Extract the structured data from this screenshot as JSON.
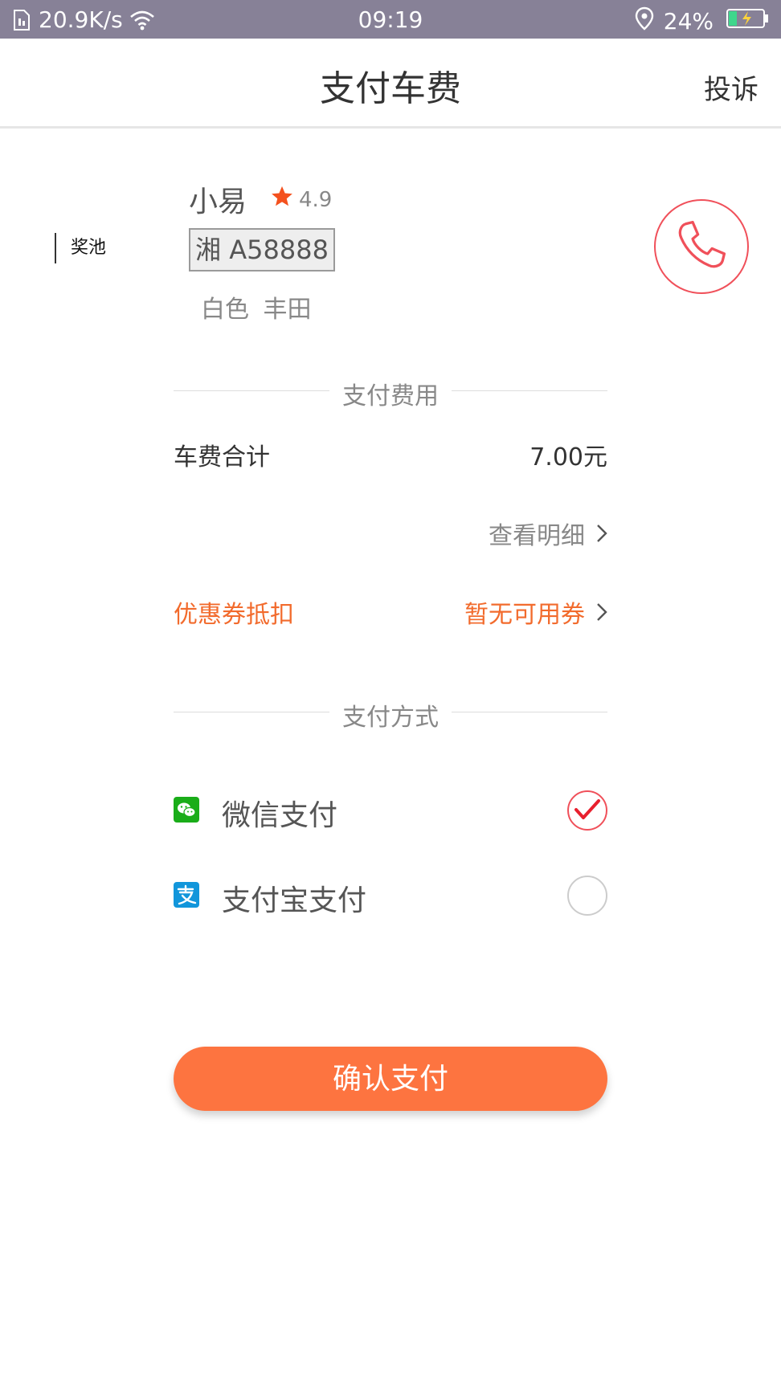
{
  "status_bar": {
    "network_speed": "20.9K/s",
    "time": "09:19",
    "battery": "24%"
  },
  "header": {
    "title": "支付车费",
    "complain": "投诉"
  },
  "driver": {
    "jackpot_label": "奖池",
    "name": "小易",
    "rating": "4.9",
    "plate": "湘 A58888",
    "car_info": "白色 丰田"
  },
  "payment_fee": {
    "section_title": "支付费用",
    "fare_label": "车费合计",
    "fare_value": "7.00元",
    "detail_link": "查看明细",
    "coupon_label": "优惠券抵扣",
    "coupon_value": "暂无可用券"
  },
  "payment_method": {
    "section_title": "支付方式",
    "options": [
      {
        "label": "微信支付",
        "icon": "wechat-pay-icon",
        "selected": true
      },
      {
        "label": "支付宝支付",
        "icon": "alipay-icon",
        "selected": false
      }
    ]
  },
  "confirm_button": "确认支付",
  "colors": {
    "status_bar": "#878197",
    "accent_orange": "#fd7440",
    "coupon_orange": "#f26b2d",
    "call_red": "#f0505a",
    "wechat_green": "#1aad19",
    "alipay_blue": "#1296db"
  }
}
